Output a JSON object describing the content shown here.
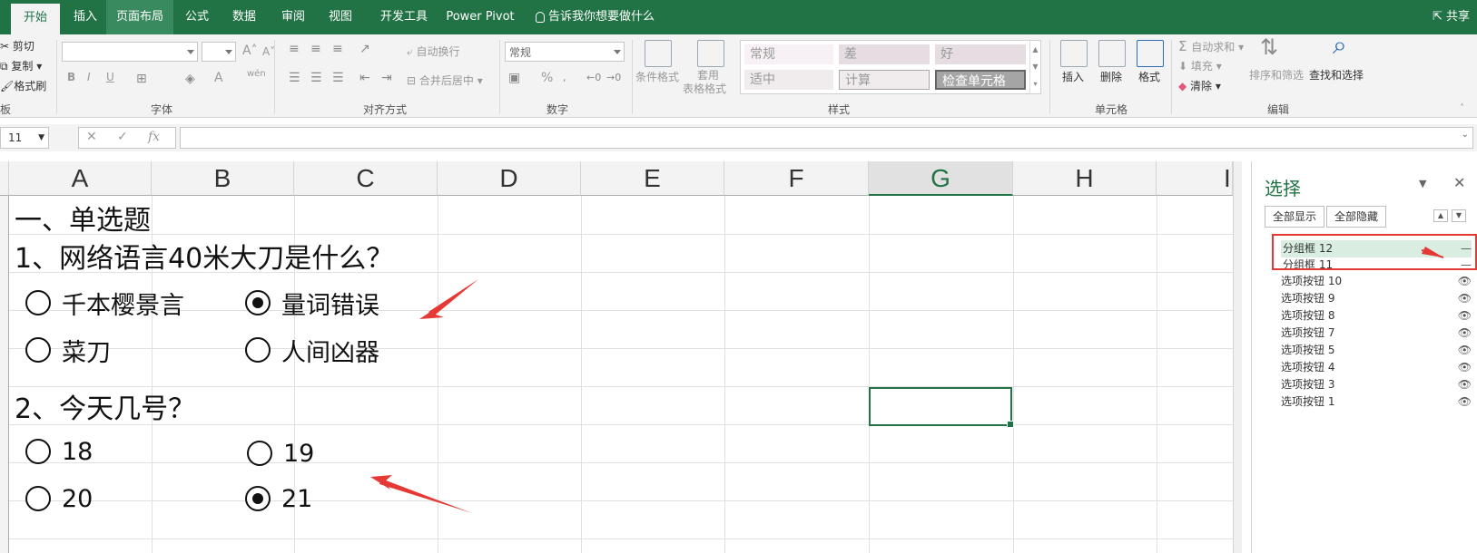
{
  "ribbon_tabs": [
    "开始",
    "插入",
    "页面布局",
    "公式",
    "数据",
    "审阅",
    "视图",
    "开发工具",
    "Power Pivot"
  ],
  "tell_me": "告诉我你想要做什么",
  "share": "共享",
  "clipboard": {
    "cut": "剪切",
    "copy": "复制",
    "format_painter": "格式刷",
    "label": "板"
  },
  "font": {
    "label": "字体",
    "bold": "B",
    "italic": "I",
    "underline": "U",
    "grow": "A",
    "shrink": "A",
    "wen": "wén"
  },
  "alignment": {
    "label": "对齐方式",
    "wrap": "自动换行",
    "merge": "合并后居中"
  },
  "number": {
    "label": "数字",
    "format": "常规",
    "percent": "%"
  },
  "styles": {
    "label": "样式",
    "conditional": "条件格式",
    "table_line1": "套用",
    "table_line2": "表格格式",
    "gallery": [
      "常规",
      "差",
      "好",
      "适中",
      "计算",
      "检查单元格"
    ]
  },
  "cells": {
    "label": "单元格",
    "insert": "插入",
    "delete": "删除",
    "format": "格式"
  },
  "editing": {
    "label": "编辑",
    "autosum": "自动求和",
    "fill": "填充",
    "clear": "清除",
    "sort": "排序和筛选",
    "find": "查找和选择"
  },
  "formula_bar": {
    "name_box": "11",
    "fx": "fx"
  },
  "columns": [
    "A",
    "B",
    "C",
    "D",
    "E",
    "F",
    "G",
    "H",
    "I"
  ],
  "sheet": {
    "section_title": "一、单选题",
    "q1": "1、网络语言40米大刀是什么？",
    "q1_options": [
      {
        "label": "千本樱景言",
        "checked": false
      },
      {
        "label": "量词错误",
        "checked": true
      },
      {
        "label": "菜刀",
        "checked": false
      },
      {
        "label": "人间凶器",
        "checked": false
      }
    ],
    "q2": "2、今天几号？",
    "q2_options": [
      {
        "label": "18",
        "checked": false
      },
      {
        "label": "19",
        "checked": false
      },
      {
        "label": "20",
        "checked": false
      },
      {
        "label": "21",
        "checked": true
      }
    ]
  },
  "selection_pane": {
    "title": "选择",
    "show_all": "全部显示",
    "hide_all": "全部隐藏",
    "items": [
      {
        "name": "分组框 12",
        "vis": "—"
      },
      {
        "name": "分组框 11",
        "vis": "—"
      },
      {
        "name": "选项按钮 10",
        "vis": "👁"
      },
      {
        "name": "选项按钮 9",
        "vis": "👁"
      },
      {
        "name": "选项按钮 8",
        "vis": "👁"
      },
      {
        "name": "选项按钮 7",
        "vis": "👁"
      },
      {
        "name": "选项按钮 5",
        "vis": "👁"
      },
      {
        "name": "选项按钮 4",
        "vis": "👁"
      },
      {
        "name": "选项按钮 3",
        "vis": "👁"
      },
      {
        "name": "选项按钮 1",
        "vis": "👁"
      }
    ]
  },
  "colors": {
    "excel_green": "#217346",
    "annotation_red": "#e53935"
  }
}
